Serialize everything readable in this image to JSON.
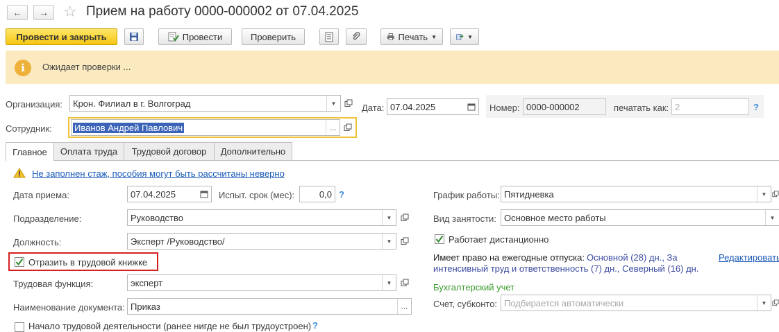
{
  "window": {
    "title": "Прием на работу 0000-000002 от 07.04.2025"
  },
  "nav": {
    "back": "←",
    "forward": "→",
    "star": "☆"
  },
  "toolbar": {
    "post_close": "Провести и закрыть",
    "post": "Провести",
    "check": "Проверить",
    "print": "Печать"
  },
  "banner": {
    "text": "Ожидает проверки ..."
  },
  "header": {
    "org_label": "Организация:",
    "org_value": "Крон. Филиал в г. Волгоград",
    "date_label": "Дата:",
    "date_value": "07.04.2025",
    "number_label": "Номер:",
    "number_value": "0000-000002",
    "print_as_label": "печатать как:",
    "print_as_placeholder": "2",
    "employee_label": "Сотрудник:",
    "employee_value": "Иванов Андрей Павлович",
    "help": "?"
  },
  "tabs": [
    {
      "label": "Главное"
    },
    {
      "label": "Оплата труда"
    },
    {
      "label": "Трудовой договор"
    },
    {
      "label": "Дополнительно"
    }
  ],
  "main": {
    "warning_link": "Не заполнен стаж, пособия могут быть рассчитаны неверно",
    "hire_date_label": "Дата приема:",
    "hire_date_value": "07.04.2025",
    "probation_label": "Испыт. срок (мес):",
    "probation_value": "0,0",
    "department_label": "Подразделение:",
    "department_value": "Руководство",
    "position_label": "Должность:",
    "position_value": "Эксперт /Руководство/",
    "workbook_label": "Отразить в трудовой книжке",
    "labor_function_label": "Трудовая функция:",
    "labor_function_value": "эксперт",
    "doc_name_label": "Наименование документа:",
    "doc_name_value": "Приказ",
    "first_job_label": "Начало трудовой деятельности (ранее нигде не был трудоустроен)",
    "schedule_label": "График работы:",
    "schedule_value": "Пятидневка",
    "employment_label": "Вид занятости:",
    "employment_value": "Основное место работы",
    "remote_label": "Работает дистанционно",
    "vacation_label": "Имеет право на ежегодные отпуска:",
    "vacation_value_1": "Основной (28) дн., За",
    "vacation_value_2": "интенсивный труд и ответственность (7) дн., Северный (16) дн.",
    "edit_link": "Редактировать",
    "accounting_title": "Бухгалтерский учет",
    "account_label": "Счет, субконто:",
    "account_placeholder": "Подбирается автоматически"
  },
  "colors": {
    "primary_button": "#f5c612",
    "banner_bg": "#fbe9bf",
    "highlight_border": "#d61f1f",
    "link": "#1a5bb8",
    "accent_green": "#3a9a2c"
  }
}
